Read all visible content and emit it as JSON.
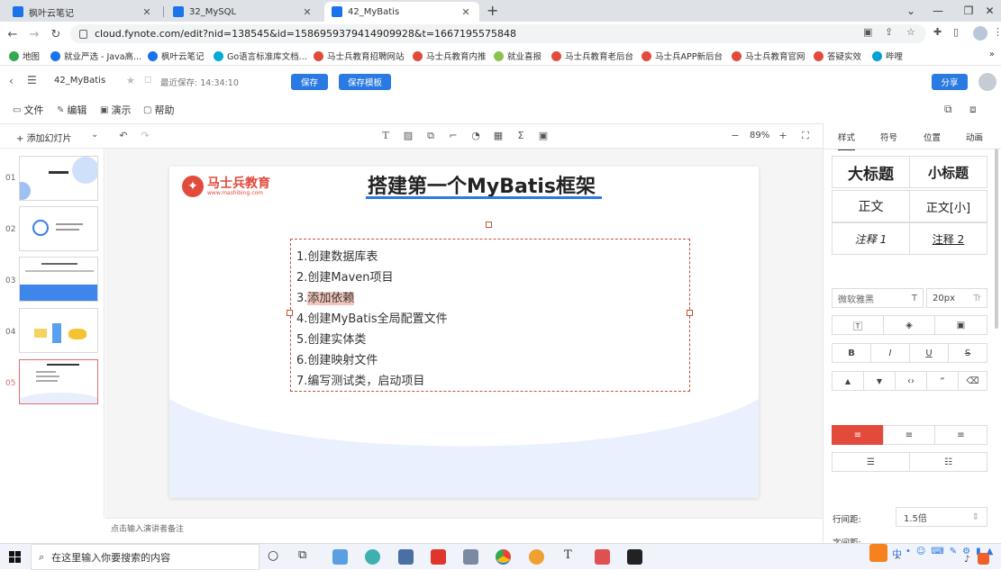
{
  "browser": {
    "tabs": [
      {
        "title": "枫叶云笔记",
        "active": false
      },
      {
        "title": "32_MySQL",
        "active": false
      },
      {
        "title": "42_MyBatis",
        "active": true
      }
    ],
    "new_tab": "+",
    "url": "cloud.fynote.com/edit?nid=138545&id=1586959379414909928&t=1667195575848",
    "bookmarks": [
      {
        "label": "地图",
        "color": "#34a853"
      },
      {
        "label": "就业严选 - Java高...",
        "color": "#1a73e8"
      },
      {
        "label": "枫叶云笔记",
        "color": "#1a73e8"
      },
      {
        "label": "Go语言标准库文档...",
        "color": "#00acd7"
      },
      {
        "label": "马士兵教育招聘网站",
        "color": "#e24a3b"
      },
      {
        "label": "马士兵教育内推",
        "color": "#e24a3b"
      },
      {
        "label": "就业喜报",
        "color": "#8bc34a"
      },
      {
        "label": "马士兵教育老后台",
        "color": "#e24a3b"
      },
      {
        "label": "马士兵APP新后台",
        "color": "#e24a3b"
      },
      {
        "label": "马士兵教育官网",
        "color": "#e24a3b"
      },
      {
        "label": "答疑实效",
        "color": "#e24a3b"
      },
      {
        "label": "哔哩",
        "color": "#00a1d6"
      }
    ]
  },
  "app": {
    "doc_title": "42_MyBatis",
    "last_saved": "最近保存: 14:34:10",
    "save_label": "保存",
    "save_template_label": "保存模板",
    "share_label": "分享",
    "menus": [
      "文件",
      "编辑",
      "演示",
      "帮助"
    ],
    "add_slide_label": "添加幻灯片",
    "zoom": "89%",
    "notes_placeholder": "点击输入演讲者备注"
  },
  "thumbnails": [
    {
      "num": "01",
      "selected": false
    },
    {
      "num": "02",
      "selected": false
    },
    {
      "num": "03",
      "selected": false
    },
    {
      "num": "04",
      "selected": false
    },
    {
      "num": "05",
      "selected": true
    }
  ],
  "slide": {
    "logo_cn": "马士兵教育",
    "logo_en": "www.mashibing.com",
    "title": "搭建第一个MyBatis框架",
    "steps": [
      "1.创建数据库表",
      "2.创建Maven项目",
      "3.",
      "4.创建MyBatis全局配置文件",
      "5.创建实体类",
      "6.创建映射文件",
      "7.编写测试类，启动项目"
    ],
    "highlighted_step_text": "添加依赖"
  },
  "panel": {
    "tabs": [
      "样式",
      "符号",
      "位置",
      "动画"
    ],
    "styles": {
      "h1": "大标题",
      "h2": "小标题",
      "body": "正文",
      "body_small": "正文[小]",
      "note1": "注释 1",
      "note2": "注释 2"
    },
    "font_family": "微软雅黑",
    "font_size": "20px",
    "line_height_label": "行间距:",
    "line_height_value": "1.5倍",
    "letter_spacing_label": "字间距:"
  },
  "taskbar": {
    "search_placeholder": "在这里输入你要搜索的内容",
    "ime_label": "中"
  },
  "colors": {
    "accent": "#2a7ae2",
    "brand": "#e24a3b",
    "align_active": "#e24a3b"
  }
}
